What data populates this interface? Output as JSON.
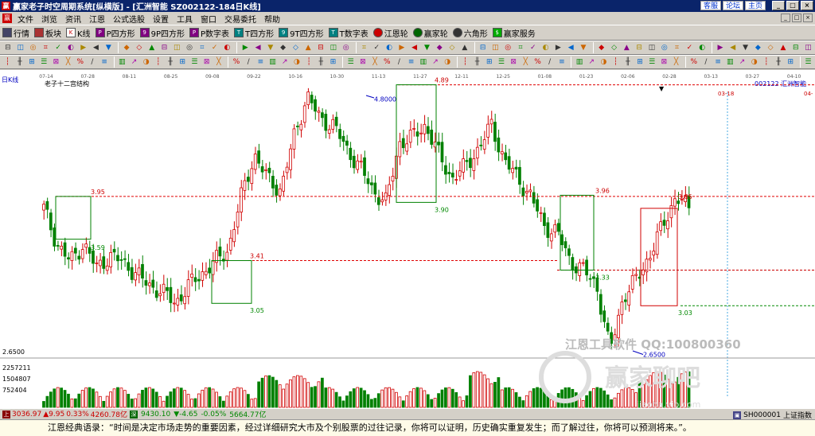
{
  "window": {
    "title": "赢家老子时空周期系统[纵横版] - [汇洲智能  SZ002122-184日K线]",
    "links": [
      "客服",
      "论坛",
      "主页"
    ],
    "controls": [
      "_",
      "□",
      "×"
    ]
  },
  "menu": [
    "文件",
    "浏览",
    "资讯",
    "江恩",
    "公式选股",
    "设置",
    "工具",
    "窗口",
    "交易委托",
    "帮助"
  ],
  "toolbar1": [
    {
      "label": "行情",
      "icon": "grid-icon"
    },
    {
      "label": "板块",
      "icon": "block-icon"
    },
    {
      "label": "K线",
      "icon": "kline-icon"
    },
    {
      "label": "P四方形",
      "icon": "p-square-icon"
    },
    {
      "label": "9P四方形",
      "icon": "9p-square-icon"
    },
    {
      "label": "P数字表",
      "icon": "p-number-icon"
    },
    {
      "label": "T四方形",
      "icon": "t-square-icon"
    },
    {
      "label": "9T四方形",
      "icon": "9t-square-icon"
    },
    {
      "label": "T数字表",
      "icon": "t-number-icon"
    },
    {
      "label": "江恩轮",
      "icon": "gann-wheel-icon"
    },
    {
      "label": "赢家轮",
      "icon": "winner-wheel-icon"
    },
    {
      "label": "六角形",
      "icon": "hexagon-icon"
    },
    {
      "label": "赢家服务",
      "icon": "service-icon"
    }
  ],
  "chart": {
    "period_label": "日K线",
    "indicator_title": "老子十二宫结构",
    "stock_label": "002122  汇洲智能",
    "date_ticks": [
      "07-14",
      "07-28",
      "08-11",
      "08-25",
      "09-08",
      "09-22",
      "10-16",
      "10-30",
      "11-13",
      "11-27",
      "12-11",
      "12-25",
      "01-08",
      "01-23",
      "02-06",
      "02-28",
      "03-13",
      "03-27",
      "04-10"
    ],
    "future_date": "03-18",
    "right_cut": "04-",
    "price_labels": [
      "4.8000",
      "4.89",
      "3.95",
      "3.96",
      "3.85",
      "3.90",
      "3.59",
      "3.41",
      "3.33",
      "3.05",
      "3.03",
      "2.6500"
    ],
    "low_axis_label": "2.6500",
    "volume_ticks": [
      "2257211",
      "1504807",
      "752404"
    ],
    "watermark_line1": "江恩工具软件 QQ:100800360",
    "watermark_line2": "赢家聊吧",
    "watermark_url": "jiaoba.vip.com",
    "colors": {
      "up": "#d00000",
      "down": "#008000",
      "level": "#e00000",
      "box": "#008000",
      "box_red": "#d00000"
    }
  },
  "status": {
    "sh_index": "3036.97",
    "sh_change": "9.95",
    "sh_pct": "0.33%",
    "sh_amount": "4260.78亿",
    "sz_index": "9430.10",
    "sz_change": "-4.65",
    "sz_pct": "-0.05%",
    "sz_amount": "5664.77亿",
    "right_code": "SH000001",
    "right_name": "上证指数"
  },
  "quote": "江恩经典语录：“时间是决定市场走势的重要因素，经过详细研究大市及个别股票的过往记录，你将可以证明，历史确实重复发生；而了解过往，你将可以预测将来。”。"
}
